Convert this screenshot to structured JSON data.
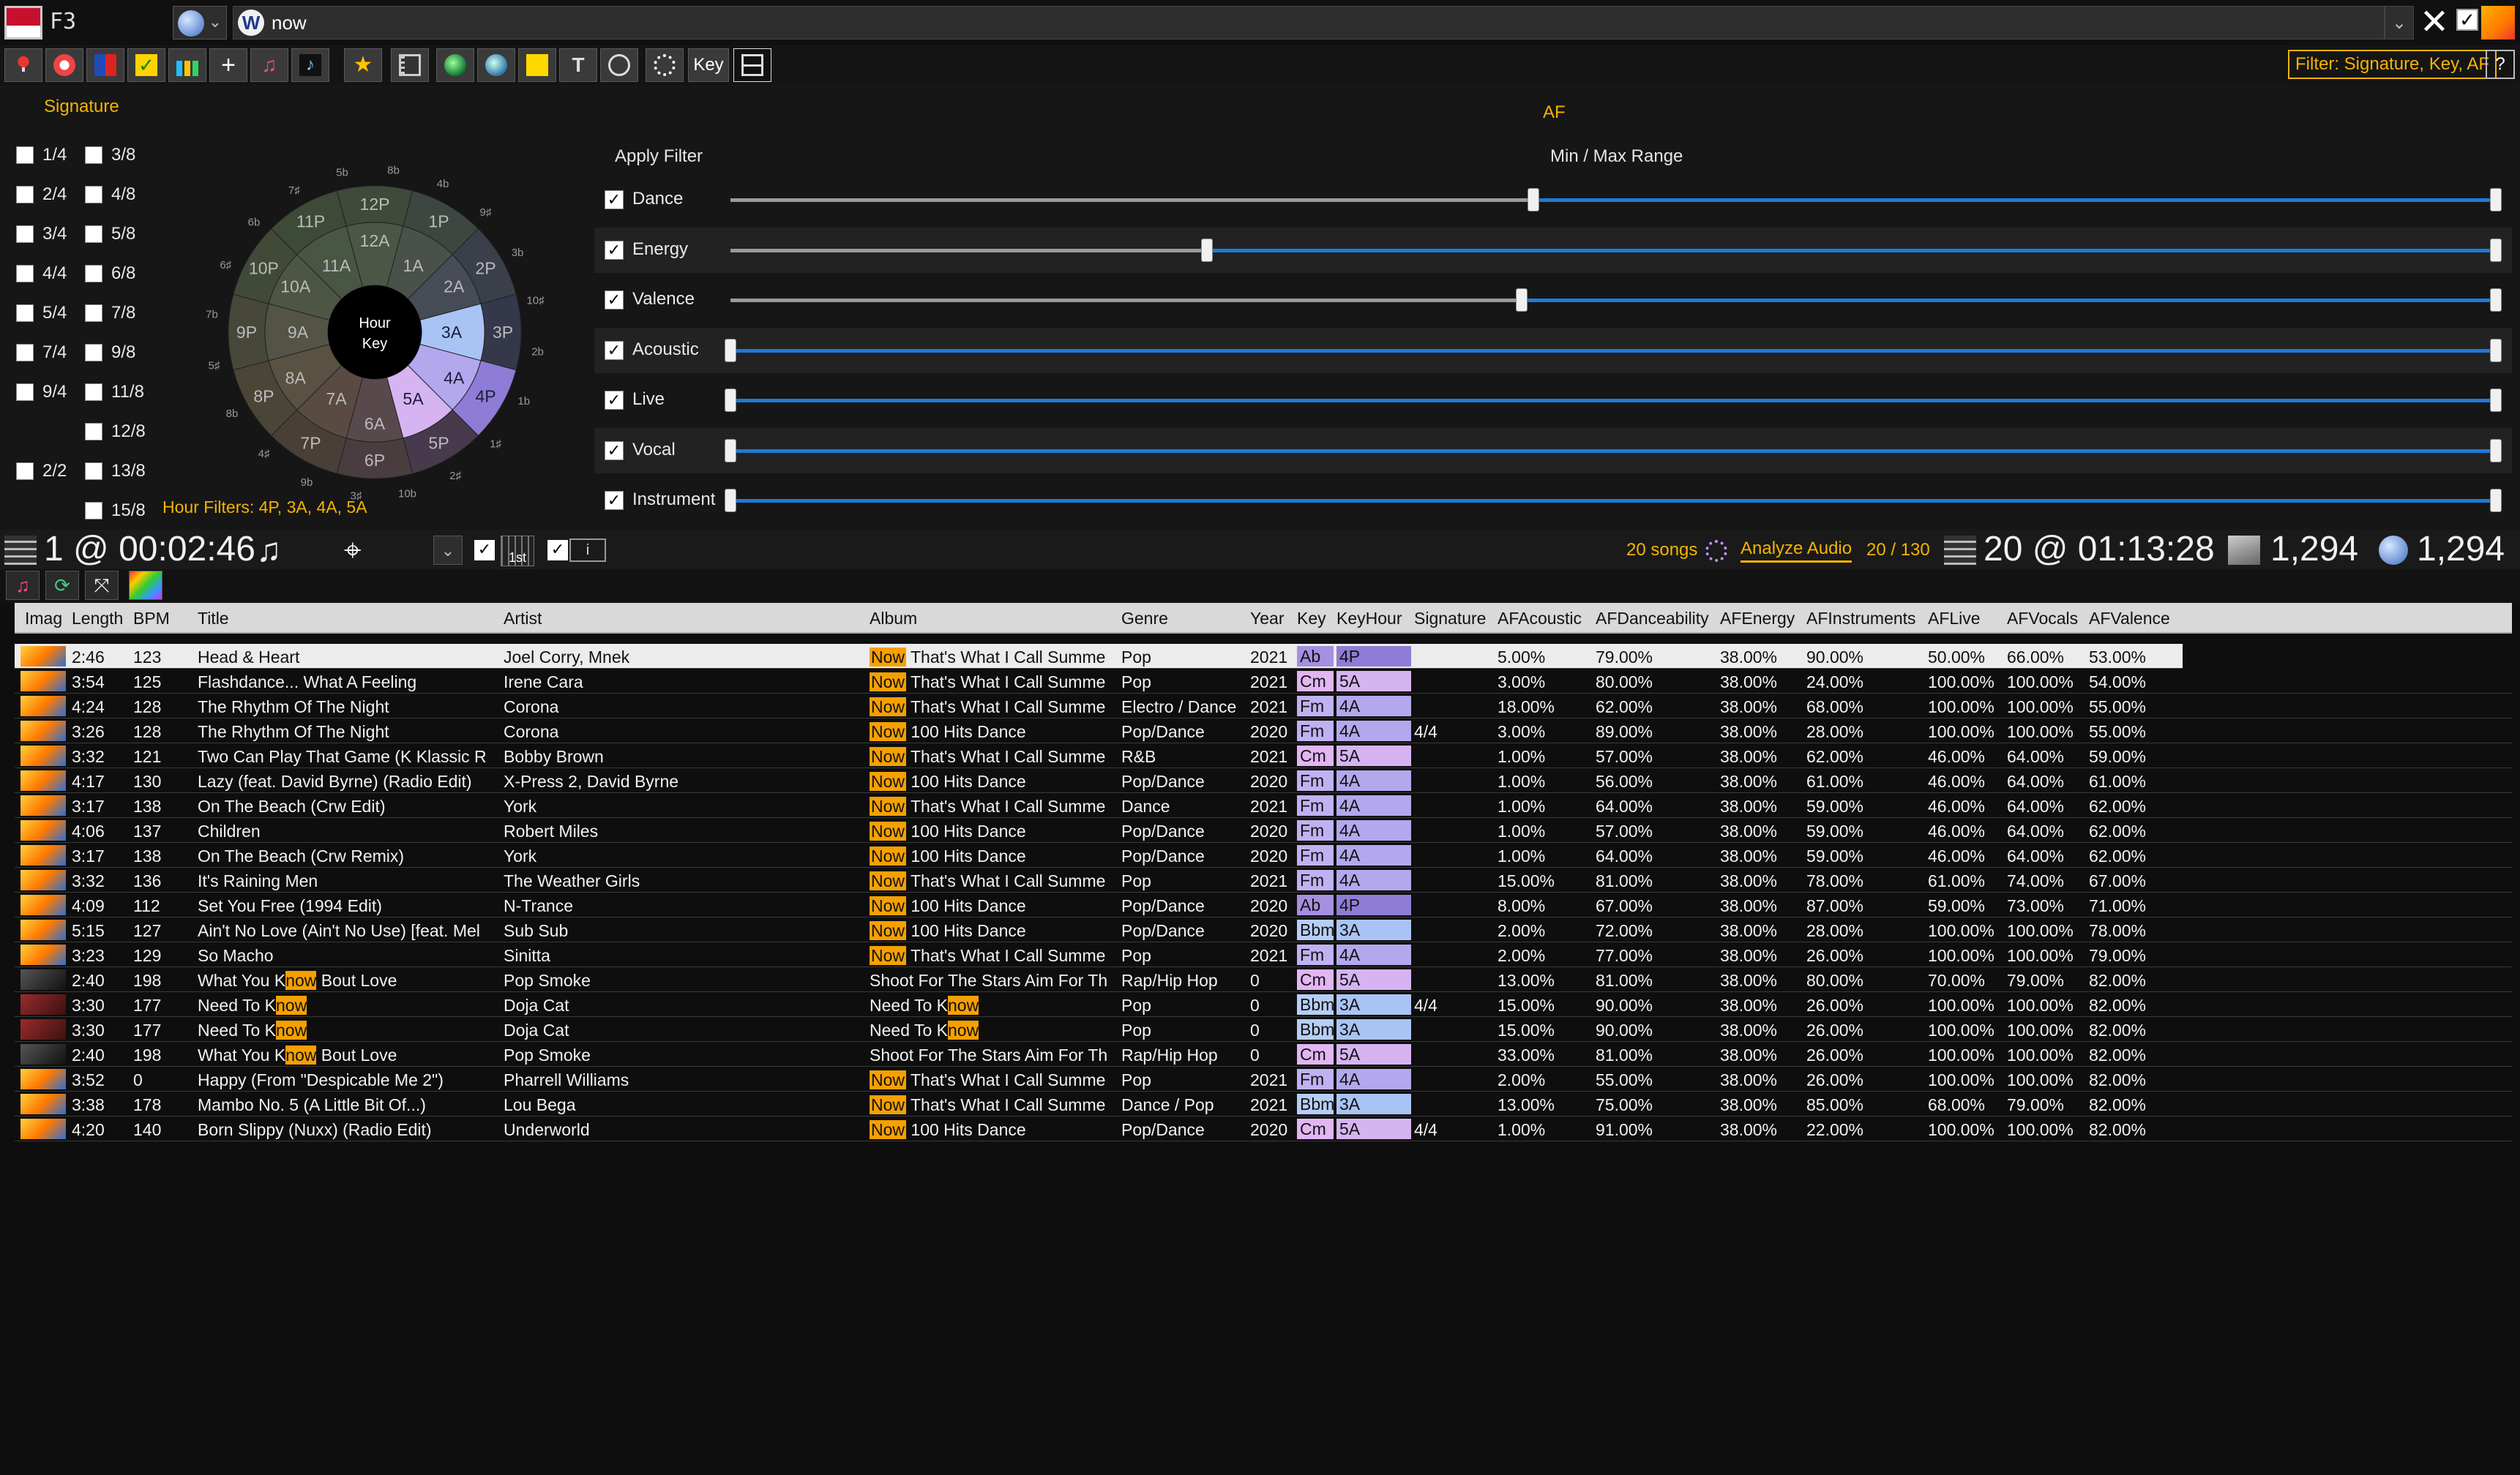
{
  "topbar": {
    "fkey": "F3",
    "w_badge": "W",
    "search_value": "now",
    "clear": "✕",
    "check": "✓",
    "drop_arrow": "⌄"
  },
  "toolbar": {
    "key_label": "Key",
    "filter_label": "Filter: Signature, Key, AF",
    "help_label": "?"
  },
  "signature": {
    "title": "Signature",
    "items": [
      {
        "label": "1/4",
        "checked": false
      },
      {
        "label": "3/8",
        "checked": false
      },
      {
        "label": "2/4",
        "checked": false
      },
      {
        "label": "4/8",
        "checked": false
      },
      {
        "label": "3/4",
        "checked": false
      },
      {
        "label": "5/8",
        "checked": false
      },
      {
        "label": "4/4",
        "checked": false
      },
      {
        "label": "6/8",
        "checked": false
      },
      {
        "label": "5/4",
        "checked": false
      },
      {
        "label": "7/8",
        "checked": false
      },
      {
        "label": "7/4",
        "checked": false
      },
      {
        "label": "9/8",
        "checked": false
      },
      {
        "label": "9/4",
        "checked": false
      },
      {
        "label": "11/8",
        "checked": false
      },
      {
        "label": "12/8",
        "checked": false
      },
      {
        "label": "2/2",
        "checked": false
      },
      {
        "label": "13/8",
        "checked": false
      },
      {
        "label": "15/8",
        "checked": false
      }
    ],
    "hour_filters": "Hour Filters: 4P, 3A, 4A, 5A"
  },
  "key_wheel": {
    "center_line1": "Hour",
    "center_line2": "Key",
    "outer": [
      "12P",
      "1P",
      "2P",
      "3P",
      "4P",
      "5P",
      "6P",
      "7P",
      "8P",
      "9P",
      "10P",
      "11P"
    ],
    "inner": [
      "12A",
      "1A",
      "2A",
      "3A",
      "4A",
      "5A",
      "6A",
      "7A",
      "8A",
      "9A",
      "10A",
      "11A"
    ],
    "ring": [
      "5b",
      "8b",
      "4b",
      "9♯",
      "3b",
      "10♯",
      "2b",
      "1b",
      "1♯",
      "2♯",
      "10b",
      "3♯",
      "9b",
      "4♯",
      "8b",
      "5♯",
      "7b",
      "6♯",
      "6b",
      "7♯"
    ],
    "selected": [
      "4P",
      "3A",
      "4A",
      "5A"
    ],
    "colors": {
      "selected_outer": "#8e7cd6",
      "selected_inner": "#b3a8ee",
      "selected_5a": "#d6b4f2",
      "selected_3a": "#a9c4f4"
    }
  },
  "af": {
    "title": "AF",
    "apply_filter": "Apply Filter",
    "min_max": "Min / Max Range",
    "rows": [
      {
        "label": "Dance",
        "checked": true,
        "min": 0.455,
        "max": 1.0
      },
      {
        "label": "Energy",
        "checked": true,
        "min": 0.27,
        "max": 1.0
      },
      {
        "label": "Valence",
        "checked": true,
        "min": 0.448,
        "max": 1.0
      },
      {
        "label": "Acoustic",
        "checked": true,
        "min": 0.0,
        "max": 1.0
      },
      {
        "label": "Live",
        "checked": true,
        "min": 0.0,
        "max": 1.0
      },
      {
        "label": "Vocal",
        "checked": true,
        "min": 0.0,
        "max": 1.0
      },
      {
        "label": "Instrument",
        "checked": true,
        "min": 0.0,
        "max": 1.0
      }
    ]
  },
  "status": {
    "playcount": "1 @ 00:02:46",
    "note": "♫",
    "first_label": "1st",
    "info_label": "i",
    "songs": "20 songs",
    "analyze": "Analyze Audio",
    "progress": "20 / 130",
    "total": "20 @ 01:13:28",
    "local_count": "1,294",
    "online_count": "1,294"
  },
  "table": {
    "columns": [
      "Imag",
      "Length",
      "BPM",
      "Title",
      "Artist",
      "Album",
      "Genre",
      "Year",
      "Key",
      "KeyHour",
      "Signature",
      "AFAcoustic",
      "AFDanceability",
      "AFEnergy",
      "AFInstruments",
      "AFLive",
      "AFVocals",
      "AFValence"
    ],
    "now_tag": "Now",
    "rows": [
      {
        "thumb": "now",
        "length": "2:46",
        "bpm": "123",
        "title": "Head & Heart",
        "artist": "Joel Corry, Mnek",
        "album_now": true,
        "album": "That's What I Call Summe",
        "genre": "Pop",
        "year": "2021",
        "key": "Ab",
        "keyhour": "4P",
        "sig": "",
        "ac": "5.00%",
        "da": "79.00%",
        "en": "38.00%",
        "in": "90.00%",
        "li": "50.00%",
        "vo": "66.00%",
        "va": "53.00%"
      },
      {
        "thumb": "now",
        "length": "3:54",
        "bpm": "125",
        "title": "Flashdance... What A Feeling",
        "artist": "Irene Cara",
        "album_now": true,
        "album": "That's What I Call Summe",
        "genre": "Pop",
        "year": "2021",
        "key": "Cm",
        "keyhour": "5A",
        "sig": "",
        "ac": "3.00%",
        "da": "80.00%",
        "en": "38.00%",
        "in": "24.00%",
        "li": "100.00%",
        "vo": "100.00%",
        "va": "54.00%"
      },
      {
        "thumb": "now",
        "length": "4:24",
        "bpm": "128",
        "title": "The Rhythm Of The Night",
        "artist": "Corona",
        "album_now": true,
        "album": "That's What I Call Summe",
        "genre": "Electro / Dance",
        "year": "2021",
        "key": "Fm",
        "keyhour": "4A",
        "sig": "",
        "ac": "18.00%",
        "da": "62.00%",
        "en": "38.00%",
        "in": "68.00%",
        "li": "100.00%",
        "vo": "100.00%",
        "va": "55.00%"
      },
      {
        "thumb": "now",
        "length": "3:26",
        "bpm": "128",
        "title": "The Rhythm Of The Night",
        "artist": "Corona",
        "album_now": true,
        "album": "100 Hits Dance",
        "genre": "Pop/Dance",
        "year": "2020",
        "key": "Fm",
        "keyhour": "4A",
        "sig": "4/4",
        "ac": "3.00%",
        "da": "89.00%",
        "en": "38.00%",
        "in": "28.00%",
        "li": "100.00%",
        "vo": "100.00%",
        "va": "55.00%"
      },
      {
        "thumb": "now",
        "length": "3:32",
        "bpm": "121",
        "title": "Two Can Play That Game (K Klassic R",
        "artist": "Bobby Brown",
        "album_now": true,
        "album": "That's What I Call Summe",
        "genre": "R&B",
        "year": "2021",
        "key": "Cm",
        "keyhour": "5A",
        "sig": "",
        "ac": "1.00%",
        "da": "57.00%",
        "en": "38.00%",
        "in": "62.00%",
        "li": "46.00%",
        "vo": "64.00%",
        "va": "59.00%"
      },
      {
        "thumb": "now",
        "length": "4:17",
        "bpm": "130",
        "title": "Lazy (feat. David Byrne) (Radio Edit)",
        "artist": "X-Press 2, David Byrne",
        "album_now": true,
        "album": "100 Hits Dance",
        "genre": "Pop/Dance",
        "year": "2020",
        "key": "Fm",
        "keyhour": "4A",
        "sig": "",
        "ac": "1.00%",
        "da": "56.00%",
        "en": "38.00%",
        "in": "61.00%",
        "li": "46.00%",
        "vo": "64.00%",
        "va": "61.00%"
      },
      {
        "thumb": "now",
        "length": "3:17",
        "bpm": "138",
        "title": "On The Beach (Crw Edit)",
        "artist": "York",
        "album_now": true,
        "album": "That's What I Call Summe",
        "genre": "Dance",
        "year": "2021",
        "key": "Fm",
        "keyhour": "4A",
        "sig": "",
        "ac": "1.00%",
        "da": "64.00%",
        "en": "38.00%",
        "in": "59.00%",
        "li": "46.00%",
        "vo": "64.00%",
        "va": "62.00%"
      },
      {
        "thumb": "now",
        "length": "4:06",
        "bpm": "137",
        "title": "Children",
        "artist": "Robert Miles",
        "album_now": true,
        "album": "100 Hits Dance",
        "genre": "Pop/Dance",
        "year": "2020",
        "key": "Fm",
        "keyhour": "4A",
        "sig": "",
        "ac": "1.00%",
        "da": "57.00%",
        "en": "38.00%",
        "in": "59.00%",
        "li": "46.00%",
        "vo": "64.00%",
        "va": "62.00%"
      },
      {
        "thumb": "now",
        "length": "3:17",
        "bpm": "138",
        "title": "On The Beach (Crw Remix)",
        "artist": "York",
        "album_now": true,
        "album": "100 Hits Dance",
        "genre": "Pop/Dance",
        "year": "2020",
        "key": "Fm",
        "keyhour": "4A",
        "sig": "",
        "ac": "1.00%",
        "da": "64.00%",
        "en": "38.00%",
        "in": "59.00%",
        "li": "46.00%",
        "vo": "64.00%",
        "va": "62.00%"
      },
      {
        "thumb": "now",
        "length": "3:32",
        "bpm": "136",
        "title": "It's Raining Men",
        "artist": "The Weather Girls",
        "album_now": true,
        "album": "That's What I Call Summe",
        "genre": "Pop",
        "year": "2021",
        "key": "Fm",
        "keyhour": "4A",
        "sig": "",
        "ac": "15.00%",
        "da": "81.00%",
        "en": "38.00%",
        "in": "78.00%",
        "li": "61.00%",
        "vo": "74.00%",
        "va": "67.00%"
      },
      {
        "thumb": "now",
        "length": "4:09",
        "bpm": "112",
        "title": "Set You Free (1994 Edit)",
        "artist": "N-Trance",
        "album_now": true,
        "album": "100 Hits Dance",
        "genre": "Pop/Dance",
        "year": "2020",
        "key": "Ab",
        "keyhour": "4P",
        "sig": "",
        "ac": "8.00%",
        "da": "67.00%",
        "en": "38.00%",
        "in": "87.00%",
        "li": "59.00%",
        "vo": "73.00%",
        "va": "71.00%"
      },
      {
        "thumb": "now",
        "length": "5:15",
        "bpm": "127",
        "title": "Ain't No Love (Ain't No Use) [feat. Mel",
        "artist": "Sub Sub",
        "album_now": true,
        "album": "100 Hits Dance",
        "genre": "Pop/Dance",
        "year": "2020",
        "key": "Bbm",
        "keyhour": "3A",
        "sig": "",
        "ac": "2.00%",
        "da": "72.00%",
        "en": "38.00%",
        "in": "28.00%",
        "li": "100.00%",
        "vo": "100.00%",
        "va": "78.00%"
      },
      {
        "thumb": "now",
        "length": "3:23",
        "bpm": "129",
        "title": "So Macho",
        "artist": "Sinitta",
        "album_now": true,
        "album": "That's What I Call Summe",
        "genre": "Pop",
        "year": "2021",
        "key": "Fm",
        "keyhour": "4A",
        "sig": "",
        "ac": "2.00%",
        "da": "77.00%",
        "en": "38.00%",
        "in": "26.00%",
        "li": "100.00%",
        "vo": "100.00%",
        "va": "79.00%"
      },
      {
        "thumb": "dark",
        "length": "2:40",
        "bpm": "198",
        "title_pre": "What You K",
        "title_hl": "now",
        "title_post": " Bout Love",
        "artist": "Pop Smoke",
        "album_now": false,
        "album": "Shoot For The Stars Aim For Th",
        "genre": "Rap/Hip Hop",
        "year": "0",
        "key": "Cm",
        "keyhour": "5A",
        "sig": "",
        "ac": "13.00%",
        "da": "81.00%",
        "en": "38.00%",
        "in": "80.00%",
        "li": "70.00%",
        "vo": "79.00%",
        "va": "82.00%"
      },
      {
        "thumb": "red",
        "length": "3:30",
        "bpm": "177",
        "title_pre": "Need To K",
        "title_hl": "now",
        "title_post": "",
        "artist": "Doja Cat",
        "album_now": false,
        "album_pre": "Need To K",
        "album_hl": "now",
        "genre": "Pop",
        "year": "0",
        "key": "Bbm",
        "keyhour": "3A",
        "sig": "4/4",
        "ac": "15.00%",
        "da": "90.00%",
        "en": "38.00%",
        "in": "26.00%",
        "li": "100.00%",
        "vo": "100.00%",
        "va": "82.00%"
      },
      {
        "thumb": "red",
        "length": "3:30",
        "bpm": "177",
        "title_pre": "Need To K",
        "title_hl": "now",
        "title_post": "",
        "artist": "Doja Cat",
        "album_now": false,
        "album_pre": "Need To K",
        "album_hl": "now",
        "genre": "Pop",
        "year": "0",
        "key": "Bbm",
        "keyhour": "3A",
        "sig": "",
        "ac": "15.00%",
        "da": "90.00%",
        "en": "38.00%",
        "in": "26.00%",
        "li": "100.00%",
        "vo": "100.00%",
        "va": "82.00%"
      },
      {
        "thumb": "dark",
        "length": "2:40",
        "bpm": "198",
        "title_pre": "What You K",
        "title_hl": "now",
        "title_post": " Bout Love",
        "artist": "Pop Smoke",
        "album_now": false,
        "album": "Shoot For The Stars Aim For Th",
        "genre": "Rap/Hip Hop",
        "year": "0",
        "key": "Cm",
        "keyhour": "5A",
        "sig": "",
        "ac": "33.00%",
        "da": "81.00%",
        "en": "38.00%",
        "in": "26.00%",
        "li": "100.00%",
        "vo": "100.00%",
        "va": "82.00%"
      },
      {
        "thumb": "now",
        "length": "3:52",
        "bpm": "0",
        "title": "Happy (From \"Despicable Me 2\")",
        "artist": "Pharrell Williams",
        "album_now": true,
        "album": "That's What I Call Summe",
        "genre": "Pop",
        "year": "2021",
        "key": "Fm",
        "keyhour": "4A",
        "sig": "",
        "ac": "2.00%",
        "da": "55.00%",
        "en": "38.00%",
        "in": "26.00%",
        "li": "100.00%",
        "vo": "100.00%",
        "va": "82.00%"
      },
      {
        "thumb": "now",
        "length": "3:38",
        "bpm": "178",
        "title": "Mambo No. 5 (A Little Bit Of...)",
        "artist": "Lou Bega",
        "album_now": true,
        "album": "That's What I Call Summe",
        "genre": "Dance / Pop",
        "year": "2021",
        "key": "Bbm",
        "keyhour": "3A",
        "sig": "",
        "ac": "13.00%",
        "da": "75.00%",
        "en": "38.00%",
        "in": "85.00%",
        "li": "68.00%",
        "vo": "79.00%",
        "va": "82.00%"
      },
      {
        "thumb": "now",
        "length": "4:20",
        "bpm": "140",
        "title": "Born Slippy (Nuxx) (Radio Edit)",
        "artist": "Underworld",
        "album_now": true,
        "album": "100 Hits Dance",
        "genre": "Pop/Dance",
        "year": "2020",
        "key": "Cm",
        "keyhour": "5A",
        "sig": "4/4",
        "ac": "1.00%",
        "da": "91.00%",
        "en": "38.00%",
        "in": "22.00%",
        "li": "100.00%",
        "vo": "100.00%",
        "va": "82.00%"
      }
    ],
    "key_colors": {
      "Ab": {
        "key": "#a58fe0",
        "hour": "#8e7cd6"
      },
      "Cm": {
        "key": "#e2b5f3",
        "hour": "#d6b4f2"
      },
      "Fm": {
        "key": "#c0b2f2",
        "hour": "#b3a8ee"
      },
      "Bbm": {
        "key": "#b6cef6",
        "hour": "#a9c4f4"
      }
    }
  }
}
